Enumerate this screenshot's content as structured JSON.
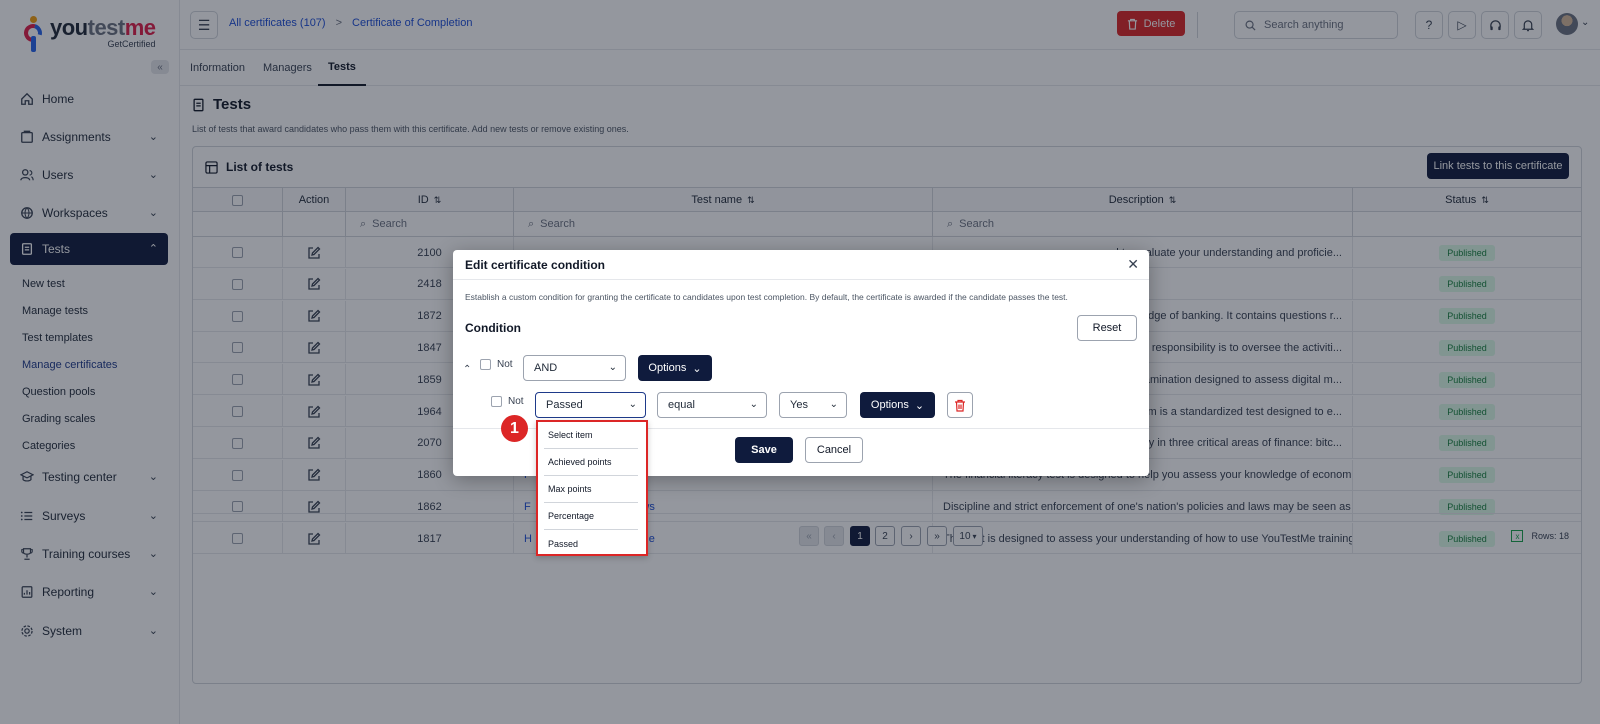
{
  "logo": {
    "name_a": "you",
    "name_b": "test",
    "name_c": "me",
    "sub": "GetCertified"
  },
  "sidebar": {
    "items": [
      {
        "label": "Home",
        "icon": "home-icon"
      },
      {
        "label": "Assignments",
        "icon": "assignments-icon"
      },
      {
        "label": "Users",
        "icon": "users-icon"
      },
      {
        "label": "Workspaces",
        "icon": "workspaces-icon"
      },
      {
        "label": "Tests",
        "icon": "tests-icon"
      },
      {
        "label": "Testing center",
        "icon": "testing-center-icon"
      },
      {
        "label": "Surveys",
        "icon": "surveys-icon"
      },
      {
        "label": "Training courses",
        "icon": "trophy-icon"
      },
      {
        "label": "Reporting",
        "icon": "reporting-icon"
      },
      {
        "label": "System",
        "icon": "gear-icon"
      }
    ],
    "sub_items": [
      "New test",
      "Manage tests",
      "Test templates",
      "Manage certificates",
      "Question pools",
      "Grading scales",
      "Categories"
    ]
  },
  "topbar": {
    "breadcrumb": [
      "All certificates (107)",
      "Certificate of Completion"
    ],
    "breadcrumb_sep": ">",
    "delete_label": "Delete",
    "search_placeholder": "Search anything"
  },
  "tabs": [
    "Information",
    "Managers",
    "Tests"
  ],
  "page": {
    "title": "Tests",
    "description": "List of tests that award candidates who pass them with this certificate. Add new tests or remove existing ones."
  },
  "card": {
    "title": "List of tests",
    "link_button": "Link tests to this certificate",
    "columns": [
      "Action",
      "ID",
      "Test name",
      "Description",
      "Status"
    ],
    "search_placeholder": "Search",
    "rows": [
      {
        "id": "2100",
        "name": "",
        "desc": "d to evaluate your understanding and proficie...",
        "status": "Published"
      },
      {
        "id": "2418",
        "name": "",
        "desc": "",
        "status": "Published"
      },
      {
        "id": "1872",
        "name": "",
        "desc": "knowledge of banking. It contains questions r...",
        "status": "Published"
      },
      {
        "id": "1847",
        "name": "",
        "desc": "rimary responsibility is to oversee the activiti...",
        "status": "Published"
      },
      {
        "id": "1859",
        "name": "",
        "desc": "ive examination designed to assess digital m...",
        "status": "Published"
      },
      {
        "id": "1964",
        "name": "",
        "desc": "on Exam is a standardized test designed to e...",
        "status": "Published"
      },
      {
        "id": "2070",
        "name": "",
        "desc": "ciency in three critical areas of finance: bitc...",
        "status": "Published"
      },
      {
        "id": "1860",
        "name": "F",
        "desc": "The financial literacy test is designed to help you assess your knowledge of economic ...",
        "status": "Published"
      },
      {
        "id": "1862",
        "name": "F            d their Strict Laws",
        "desc": "Discipline and strict enforcement of one's nation's policies and laws may be seen as ha...",
        "status": "Published"
      },
      {
        "id": "1817",
        "name": "H              es in YouTestMe",
        "desc": "This test is designed to assess your understanding of how to use YouTestMe training c...",
        "status": "Published"
      }
    ],
    "pager": {
      "pages": [
        "1",
        "2"
      ],
      "page_size": "10",
      "rows_label": "Rows: 18"
    }
  },
  "modal": {
    "title": "Edit certificate condition",
    "description": "Establish a custom condition for granting the certificate to candidates upon test completion. By default, the certificate is awarded if the candidate passes the test.",
    "condition_title": "Condition",
    "reset_label": "Reset",
    "not_label": "Not",
    "operator": "AND",
    "options_label": "Options",
    "field_value": "Passed",
    "comparator": "equal",
    "value": "Yes",
    "save_label": "Save",
    "cancel_label": "Cancel"
  },
  "dropdown": {
    "items": [
      "Select item",
      "Achieved points",
      "Max points",
      "Percentage",
      "Passed"
    ]
  },
  "step_badge": "1",
  "colors": {
    "primary": "#0f1b3d",
    "danger": "#dc2626",
    "link": "#1d4ed8",
    "success_bg": "#dcfce7",
    "success_text": "#15803d"
  }
}
